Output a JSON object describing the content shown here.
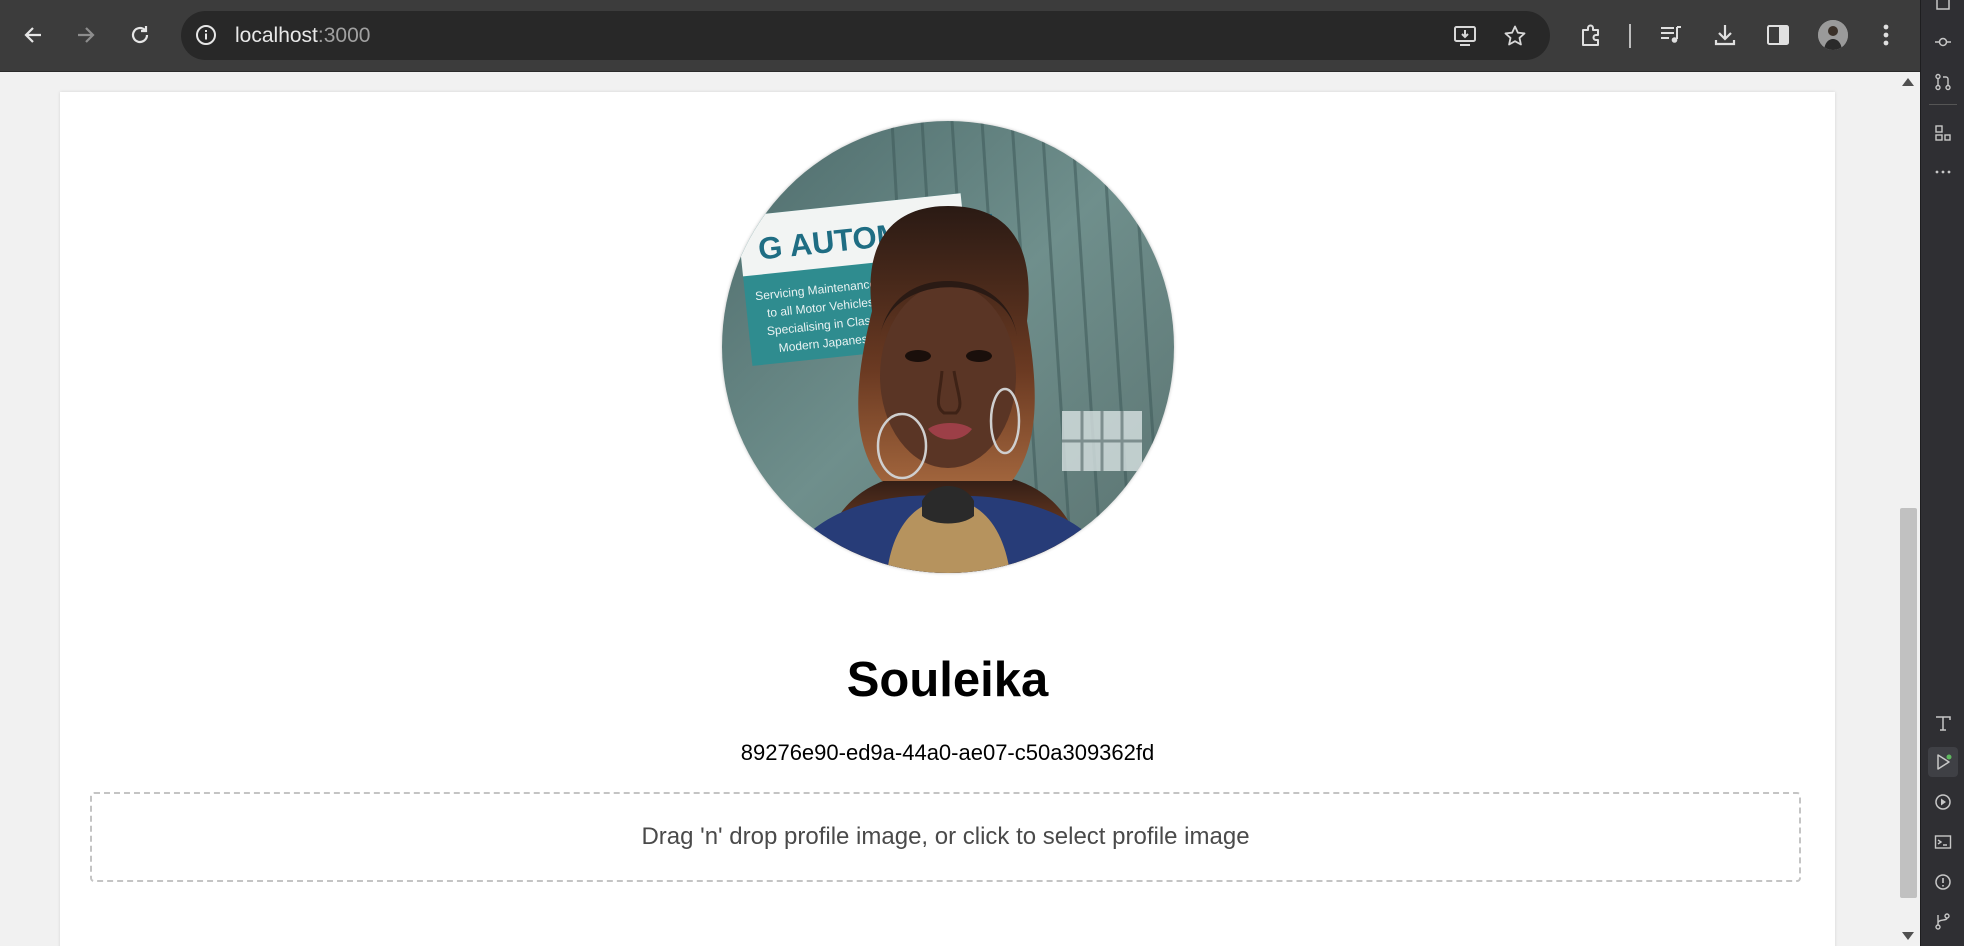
{
  "browser": {
    "url_host": "localhost",
    "url_port": ":3000",
    "icons": {
      "back": "arrow-left-icon",
      "forward": "arrow-right-icon",
      "reload": "reload-icon",
      "site_info": "info-icon",
      "install_app": "install-app-icon",
      "bookmark": "star-icon",
      "extensions": "puzzle-icon",
      "media": "media-queue-icon",
      "downloads": "download-icon",
      "side_panel": "side-panel-icon",
      "menu": "kebab-menu-icon"
    }
  },
  "profile": {
    "name": "Souleika",
    "id": "89276e90-ed9a-44a0-ae07-c50a309362fd",
    "photo_sign_text": "G AUTOMOTIVE",
    "photo_sign_sub": [
      "Servicing Maintenance & Repairs",
      "to all Motor Vehicles",
      "Specialising in Classic",
      "Modern Japanese"
    ]
  },
  "dropzone": {
    "label": "Drag 'n' drop profile image, or click to select profile image"
  },
  "colors": {
    "chrome": "#3c3c3c",
    "omnibox": "#282828",
    "page_bg": "#f1f1f1",
    "card_bg": "#ffffff",
    "dashed_border": "#c4c4c4"
  }
}
